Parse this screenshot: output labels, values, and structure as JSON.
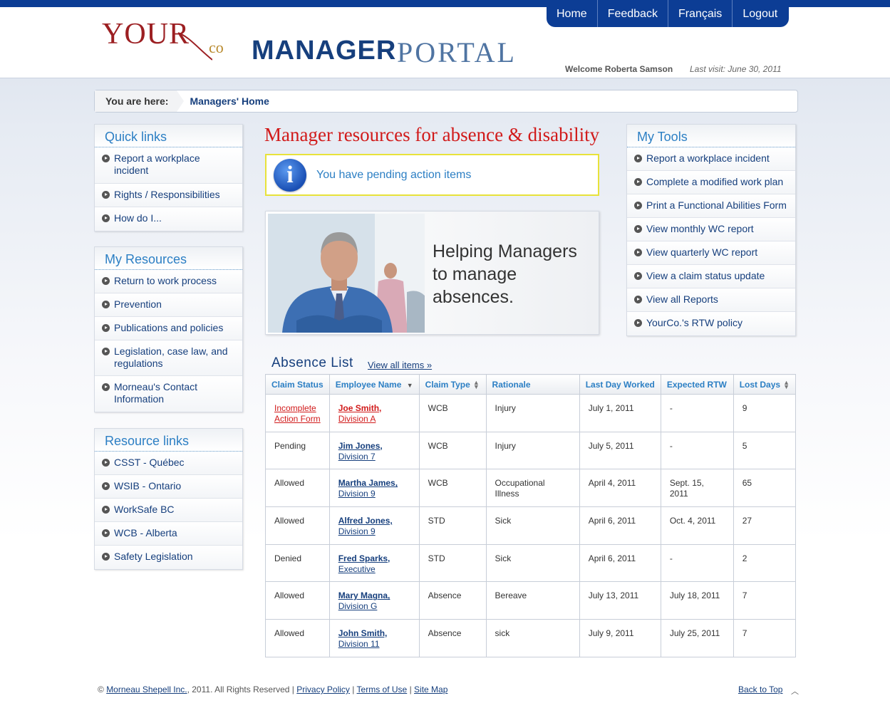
{
  "header": {
    "logo_your": "YOUR",
    "logo_co": "co",
    "logo_manager": "MANAGER",
    "logo_portal": "PORTAL",
    "nav": [
      "Home",
      "Feedback",
      "Français",
      "Logout"
    ],
    "welcome": "Welcome Roberta Samson",
    "last_visit": "Last visit: June 30, 2011"
  },
  "breadcrumb": {
    "label": "You are here:",
    "current": "Managers' Home"
  },
  "quick_links": {
    "title": "Quick links",
    "items": [
      "Report a workplace incident",
      "Rights / Responsibilities",
      "How do I..."
    ]
  },
  "my_resources": {
    "title": "My Resources",
    "items": [
      "Return to work process",
      "Prevention",
      "Publications and policies",
      "Legislation, case law, and regulations",
      "Morneau's Contact Information"
    ]
  },
  "resource_links": {
    "title": "Resource links",
    "items": [
      "CSST - Québec",
      "WSIB - Ontario",
      "WorkSafe BC",
      "WCB - Alberta",
      "Safety Legislation"
    ]
  },
  "main": {
    "title": "Manager resources for absence & disability",
    "notice": "You have pending action items",
    "info_icon_letter": "i",
    "banner_text": "Helping Managers to manage absences."
  },
  "my_tools": {
    "title": "My Tools",
    "items": [
      "Report a workplace incident",
      "Complete a modified work plan",
      "Print a Functional Abilities Form",
      "View monthly WC report",
      "View quarterly WC report",
      "View a claim status update",
      "View all Reports",
      "YourCo.'s RTW policy"
    ]
  },
  "absence_list": {
    "title": "Absence List",
    "view_all": "View all items »",
    "columns": [
      "Claim Status",
      "Employee Name",
      "Claim Type",
      "Rationale",
      "Last Day Worked",
      "Expected RTW",
      "Lost Days"
    ],
    "rows": [
      {
        "status": "Incomplete Action Form",
        "name": "Joe Smith,",
        "division": "Division A",
        "type": "WCB",
        "rationale": "Injury",
        "last_day": "July 1, 2011",
        "rtw": "-",
        "lost": "9"
      },
      {
        "status": "Pending",
        "name": "Jim Jones,",
        "division": "Division 7",
        "type": "WCB",
        "rationale": "Injury",
        "last_day": "July 5, 2011",
        "rtw": "-",
        "lost": "5"
      },
      {
        "status": "Allowed",
        "name": "Martha James,",
        "division": "Division 9",
        "type": "WCB",
        "rationale": "Occupational Illness",
        "last_day": "April 4, 2011",
        "rtw": "Sept. 15, 2011",
        "lost": "65"
      },
      {
        "status": "Allowed",
        "name": "Alfred Jones,",
        "division": "Division 9",
        "type": "STD",
        "rationale": "Sick",
        "last_day": "April 6, 2011",
        "rtw": "Oct. 4, 2011",
        "lost": "27"
      },
      {
        "status": "Denied",
        "name": "Fred Sparks,",
        "division": "Executive",
        "type": "STD",
        "rationale": "Sick",
        "last_day": "April 6, 2011",
        "rtw": "-",
        "lost": "2"
      },
      {
        "status": "Allowed",
        "name": "Mary Magna,",
        "division": "Division G",
        "type": "Absence",
        "rationale": "Bereave",
        "last_day": "July 13, 2011",
        "rtw": "July 18, 2011",
        "lost": "7"
      },
      {
        "status": "Allowed",
        "name": "John Smith,",
        "division": "Division 11",
        "type": "Absence",
        "rationale": "sick",
        "last_day": "July 9, 2011",
        "rtw": "July 25, 2011",
        "lost": "7"
      }
    ]
  },
  "footer": {
    "copyright_symbol": "©",
    "company_link": "Morneau Shepell Inc.",
    "rights": ", 2011. All Rights Reserved |",
    "privacy": "Privacy Policy",
    "sep1": "|",
    "terms": "Terms of Use",
    "sep2": "|",
    "sitemap": "Site Map",
    "back_to_top": "Back to Top"
  }
}
